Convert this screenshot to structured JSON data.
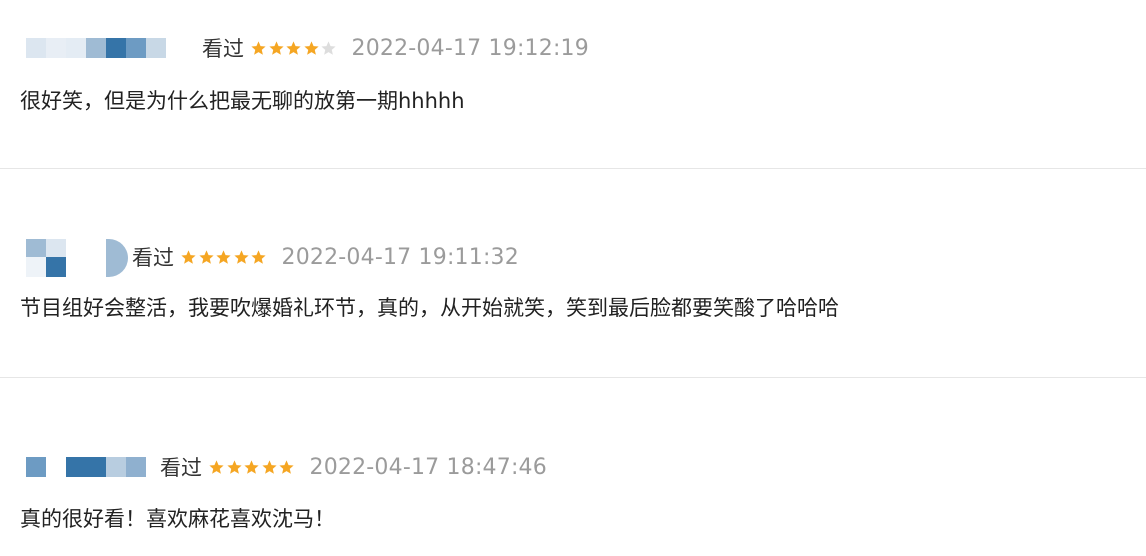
{
  "reviews": [
    {
      "status": "看过",
      "rating": 4,
      "max_rating": 5,
      "time": "2022-04-17 19:12:19",
      "text": "很好笑，但是为什么把最无聊的放第一期hhhhh"
    },
    {
      "status": "看过",
      "rating": 5,
      "max_rating": 5,
      "time": "2022-04-17 19:11:32",
      "text": "节目组好会整活，我要吹爆婚礼环节，真的，从开始就笑，笑到最后脸都要笑酸了哈哈哈"
    },
    {
      "status": "看过",
      "rating": 5,
      "max_rating": 5,
      "time": "2022-04-17 18:47:46",
      "text": "真的很好看！喜欢麻花喜欢沈马！"
    }
  ],
  "colors": {
    "star_filled": "#f5a623",
    "star_empty": "#dddddd",
    "timestamp": "#9b9b9b",
    "divider": "#e6e6e6",
    "avatar_blues": [
      "#dce6f0",
      "#9fbbd4",
      "#6d9bc3",
      "#3574a8"
    ]
  },
  "icons": {
    "rating": "star-icon",
    "username": "blurred-username"
  }
}
